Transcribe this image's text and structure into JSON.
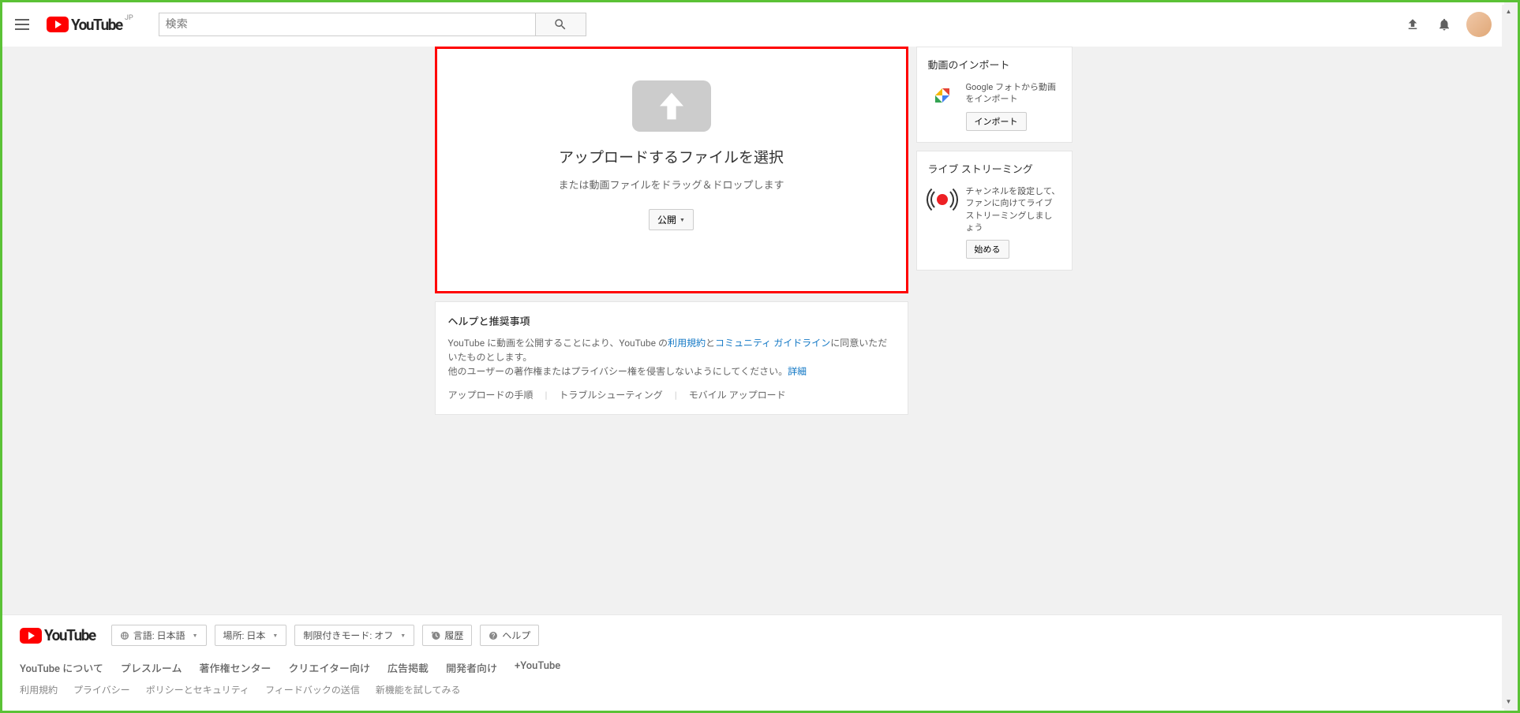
{
  "header": {
    "logo_text": "YouTube",
    "logo_region": "JP",
    "search_placeholder": "検索"
  },
  "upload": {
    "title": "アップロードするファイルを選択",
    "subtitle": "または動画ファイルをドラッグ＆ドロップします",
    "privacy": "公開"
  },
  "help": {
    "title": "ヘルプと推奨事項",
    "line1_prefix": "YouTube に動画を公開することにより、YouTube の",
    "terms": "利用規約",
    "line1_mid": "と",
    "guidelines": "コミュニティ ガイドライン",
    "line1_suffix": "に同意いただいたものとします。",
    "line2_prefix": "他のユーザーの著作権またはプライバシー権を侵害しないようにしてください。",
    "details": "詳細",
    "links": {
      "steps": "アップロードの手順",
      "trouble": "トラブルシューティング",
      "mobile": "モバイル アップロード"
    }
  },
  "sidebar": {
    "import": {
      "title": "動画のインポート",
      "text": "Google フォトから動画をインポート",
      "button": "インポート"
    },
    "live": {
      "title": "ライブ ストリーミング",
      "text": "チャンネルを設定して、ファンに向けてライブ ストリーミングしましょう",
      "button": "始める"
    }
  },
  "footer": {
    "logo_text": "YouTube",
    "buttons": {
      "language": "言語: 日本語",
      "location": "場所: 日本",
      "restricted": "制限付きモード: オフ",
      "history": "履歴",
      "help": "ヘルプ"
    },
    "links1": {
      "about": "YouTube について",
      "press": "プレスルーム",
      "copyright": "著作権センター",
      "creators": "クリエイター向け",
      "ads": "広告掲載",
      "developers": "開発者向け",
      "plus": "+YouTube"
    },
    "links2": {
      "terms": "利用規約",
      "privacy": "プライバシー",
      "policy": "ポリシーとセキュリティ",
      "feedback": "フィードバックの送信",
      "newfeat": "新機能を試してみる"
    }
  }
}
